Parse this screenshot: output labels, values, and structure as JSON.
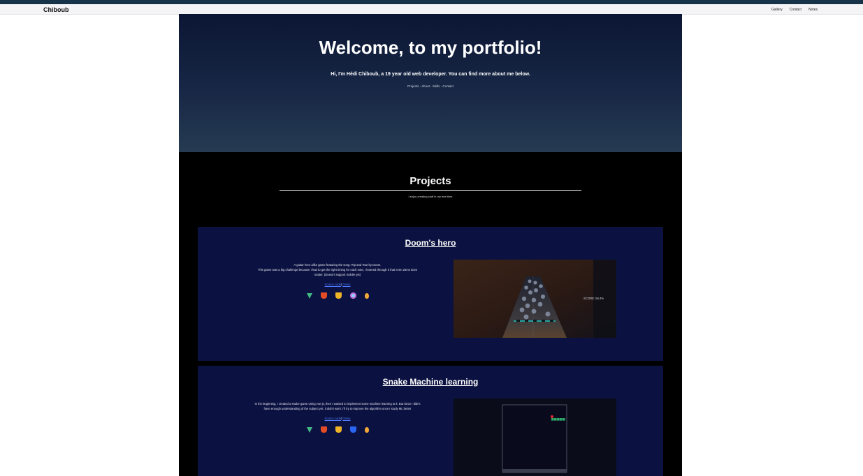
{
  "navbar": {
    "brand": "Chiboub",
    "links": [
      "Gallery",
      "Contact",
      "Notes"
    ]
  },
  "hero": {
    "title": "Welcome, to my portfolio!",
    "subtitle": "Hi, I'm Hédi Chiboub, a 19 year old web developer. You can find more about me below.",
    "links": [
      "Projects",
      "About",
      "Skills",
      "Contact"
    ],
    "separator": " - "
  },
  "projects": {
    "title": "Projects",
    "subtitle": "I enjoy creating stuff in my free time",
    "items": [
      {
        "title": "Doom's hero",
        "description_lines": [
          "A guitar hero alike game featuring the song: Rip and Tear by Doom.",
          "This game was a big challenge because I had to get the right timing for each note, I learned through it that even 25ms does",
          "matter. (Doesn't support mobile yet)"
        ],
        "source_label": "Source code",
        "demo_label": "Demo",
        "link_separator": "|",
        "tech_icons": [
          "vue-icon",
          "html5-icon",
          "javascript-icon",
          "webpack-icon",
          "hand-icon"
        ],
        "screenshot": {
          "score_text": "SCORE: 94.4%"
        }
      },
      {
        "title": "Snake Machine learning",
        "description_lines": [
          "In the beginning, I created a snake game using vue js, then I wanted to implement some machine learning to it. But since I didn't",
          "have enough understanding of the subject yet, it didn't work. I'll try to improve the algorithm once I study ML better"
        ],
        "source_label": "Source code",
        "demo_label": "Demo",
        "link_separator": "|",
        "tech_icons": [
          "vue-icon",
          "html5-icon",
          "javascript-icon",
          "css3-icon",
          "hand-icon"
        ],
        "screenshot": {}
      }
    ]
  },
  "colors": {
    "card_bg": "#0b1140",
    "page_bg": "#000000",
    "link": "#4f7cff",
    "snake_green": "#2fa86a",
    "apple_red": "#e0283a"
  }
}
